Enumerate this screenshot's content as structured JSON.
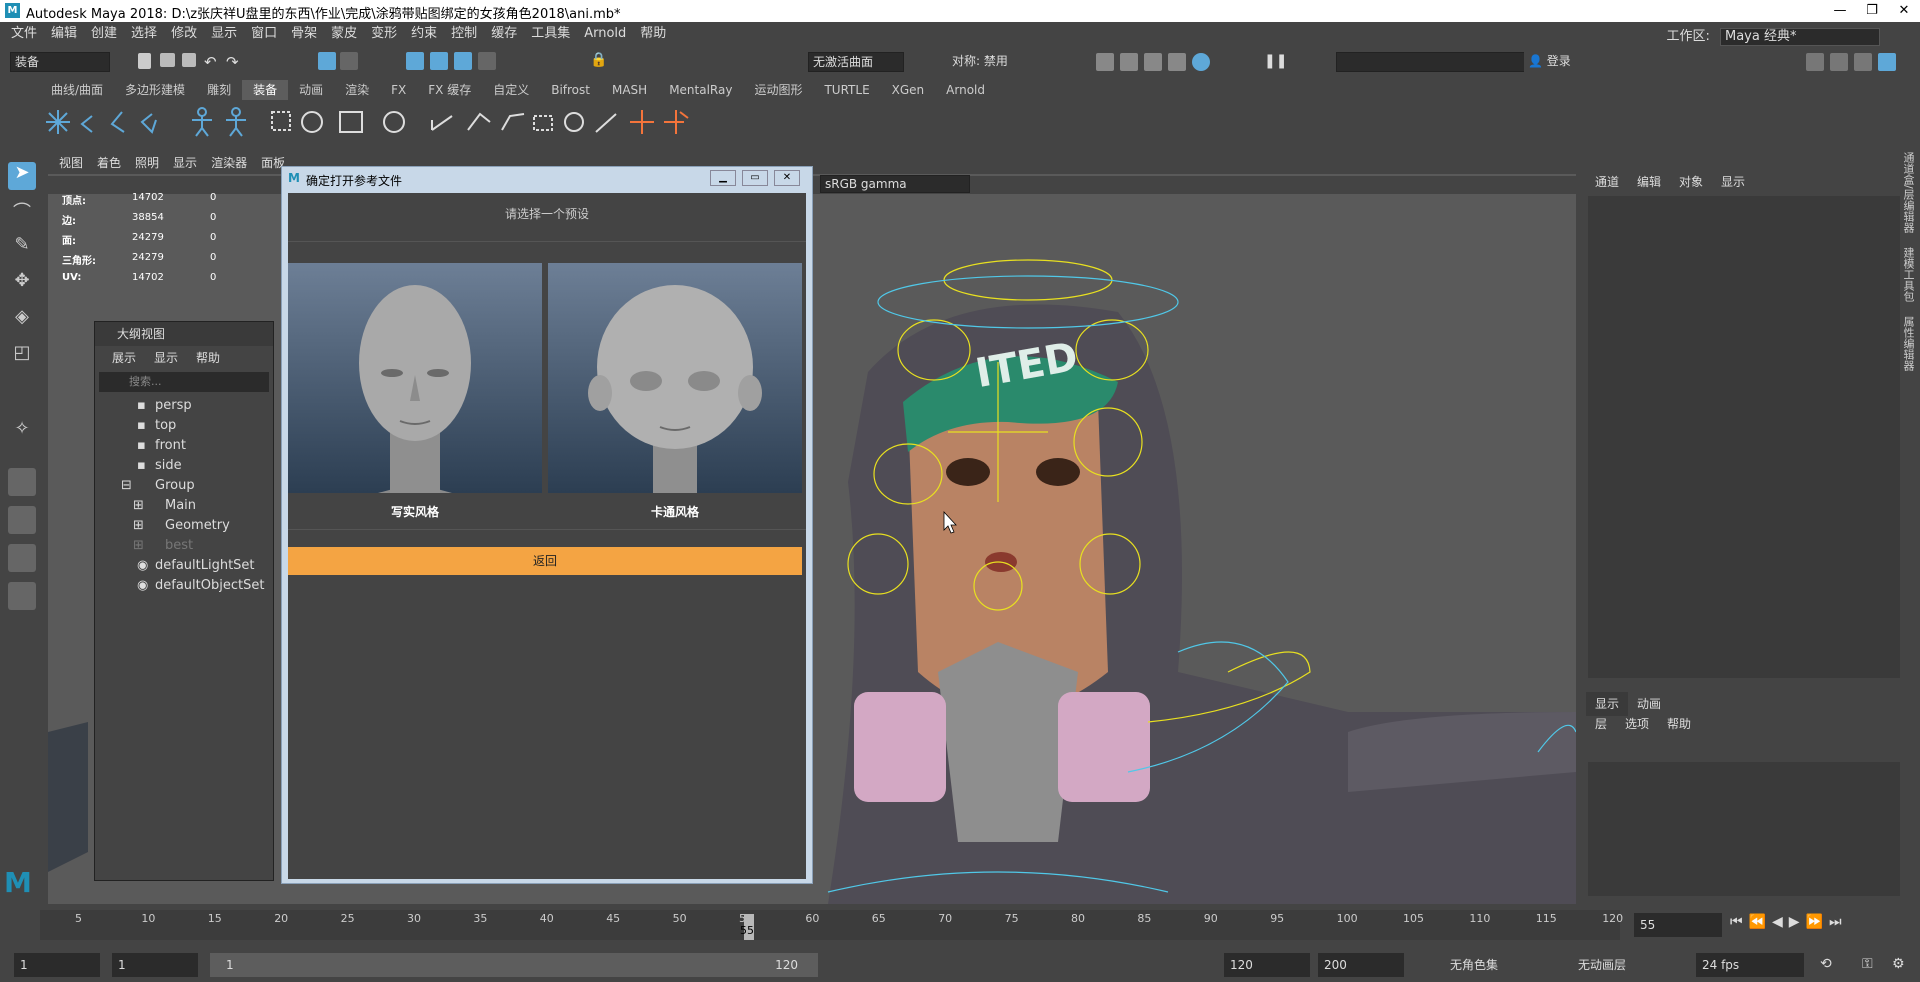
{
  "window": {
    "title": "Autodesk Maya 2018: D:\\z张庆祥U盘里的东西\\作业\\完成\\涂鸦带贴图绑定的女孩角色2018\\ani.mb*",
    "logo": "M"
  },
  "menubar": {
    "items": [
      "文件",
      "编辑",
      "创建",
      "选择",
      "修改",
      "显示",
      "窗口",
      "骨架",
      "蒙皮",
      "变形",
      "约束",
      "控制",
      "缓存",
      "工具集",
      "Arnold",
      "帮助"
    ],
    "workspace_label": "工作区:",
    "workspace_value": "Maya 经典*"
  },
  "statusline": {
    "mode": "装备",
    "live_surface": "无激活曲面",
    "symmetry": "对称: 禁用",
    "login": "登录"
  },
  "shelf": {
    "tabs": [
      "曲线/曲面",
      "多边形建模",
      "雕刻",
      "装备",
      "动画",
      "渲染",
      "FX",
      "FX 缓存",
      "自定义",
      "Bifrost",
      "MASH",
      "MentalRay",
      "运动图形",
      "TURTLE",
      "XGen",
      "Arnold"
    ],
    "active_tab": "装备"
  },
  "viewport": {
    "menu": [
      "视图",
      "着色",
      "照明",
      "显示",
      "渲染器",
      "面板"
    ],
    "color_space": "sRGB gamma",
    "hud": [
      {
        "label": "顶点:",
        "value": "14702",
        "sel": "0"
      },
      {
        "label": "边:",
        "value": "38854",
        "sel": "0"
      },
      {
        "label": "面:",
        "value": "24279",
        "sel": "0"
      },
      {
        "label": "三角形:",
        "value": "24279",
        "sel": "0"
      },
      {
        "label": "UV:",
        "value": "14702",
        "sel": "0"
      }
    ]
  },
  "outliner": {
    "title": "大纲视图",
    "menu": [
      "展示",
      "显示",
      "帮助"
    ],
    "search_placeholder": "搜索...",
    "nodes": [
      "persp",
      "top",
      "front",
      "side",
      "Group",
      "Main",
      "Geometry",
      "best",
      "defaultLightSet",
      "defaultObjectSet"
    ]
  },
  "dialog": {
    "title": "确定打开参考文件",
    "prompt": "请选择一个预设",
    "options": [
      "写实风格",
      "卡通风格"
    ],
    "back_label": "返回"
  },
  "channelbox": {
    "menu": [
      "通道",
      "编辑",
      "对象",
      "显示"
    ],
    "layer_tabs": [
      "显示",
      "动画"
    ],
    "layer_menu": [
      "层",
      "选项",
      "帮助"
    ],
    "side_tabs": [
      "通道盒/层编辑器",
      "建模工具包",
      "属性编辑器"
    ]
  },
  "timeline": {
    "ticks": [
      "5",
      "10",
      "15",
      "20",
      "25",
      "30",
      "35",
      "40",
      "45",
      "50",
      "55",
      "60",
      "65",
      "70",
      "75",
      "80",
      "85",
      "90",
      "95",
      "100",
      "105",
      "110",
      "115",
      "120"
    ],
    "current_marker": "55",
    "current_frame": "55"
  },
  "rangebar": {
    "start": "1",
    "playback_start": "1",
    "slider_start": "1",
    "slider_end": "120",
    "playback_end": "120",
    "end": "200",
    "char_set": "无角色集",
    "anim_layer": "无动画层",
    "fps": "24 fps"
  },
  "colors": {
    "back_button": "#f4a443",
    "accent_blue": "#5ea8d8",
    "rig_yellow": "#e8e020",
    "rig_cyan": "#50c8e8"
  }
}
